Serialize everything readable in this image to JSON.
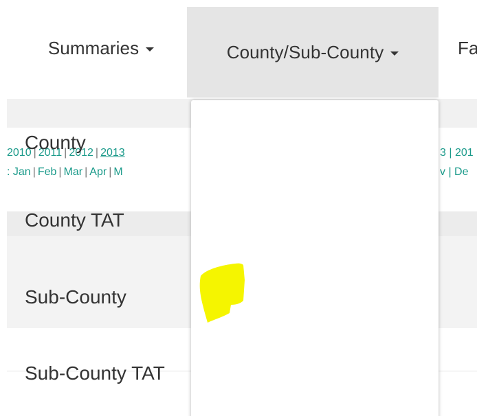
{
  "navbar": {
    "items": [
      {
        "label": "Summaries"
      },
      {
        "label": "County/Sub-County"
      },
      {
        "label": "Fa"
      }
    ]
  },
  "filters": {
    "years_left": [
      "2010",
      "2011",
      "2012",
      "2013"
    ],
    "years_left_prefix": "",
    "selected_year": "2013",
    "months_left_prefix": ": ",
    "months_left": [
      "Jan",
      "Feb",
      "Mar",
      "Apr",
      "M"
    ],
    "years_right_text": "3 | 201",
    "months_right_text": "v | De",
    "separator": "|"
  },
  "dropdown": {
    "items": [
      {
        "label": "County"
      },
      {
        "label": "County TAT"
      },
      {
        "label": "Sub-County"
      },
      {
        "label": "Sub-County TAT"
      }
    ]
  },
  "colors": {
    "link": "#1a9a8a",
    "nav_active_bg": "#e5e5e5",
    "highlight": "#f5f500"
  }
}
